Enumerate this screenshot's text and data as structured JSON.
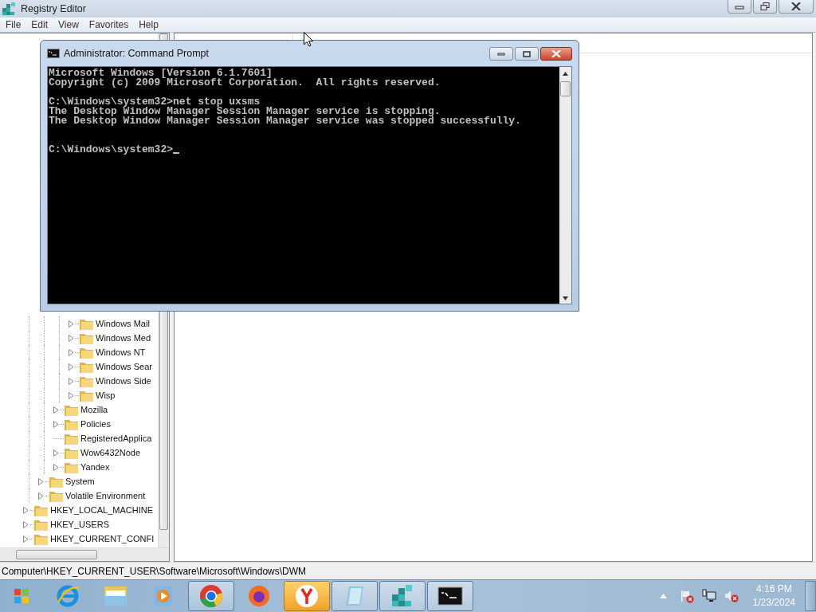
{
  "window": {
    "title": "Registry Editor"
  },
  "menu": [
    "File",
    "Edit",
    "View",
    "Favorites",
    "Help"
  ],
  "tree": [
    {
      "children": [
        {
          "children": [
            {
              "children": [
                {
                  "label": "Windows Mail",
                  "expandable": true
                },
                {
                  "label": "Windows Med",
                  "expandable": true
                },
                {
                  "label": "Windows NT",
                  "expandable": true
                },
                {
                  "label": "Windows Sear",
                  "expandable": true
                },
                {
                  "label": "Windows Side",
                  "expandable": true
                },
                {
                  "label": "Wisp",
                  "expandable": true
                }
              ]
            },
            {
              "label": "Mozilla",
              "expandable": true
            },
            {
              "label": "Policies",
              "expandable": true
            },
            {
              "label": "RegisteredApplica",
              "expandable": false
            },
            {
              "label": "Wow6432Node",
              "expandable": true
            },
            {
              "label": "Yandex",
              "expandable": true
            }
          ]
        },
        {
          "label": "System",
          "expandable": true
        },
        {
          "label": "Volatile Environment",
          "expandable": true
        }
      ]
    },
    {
      "label": "HKEY_LOCAL_MACHINE",
      "expandable": true
    },
    {
      "label": "HKEY_USERS",
      "expandable": true
    },
    {
      "label": "HKEY_CURRENT_CONFI",
      "expandable": true
    }
  ],
  "status_bar": "Computer\\HKEY_CURRENT_USER\\Software\\Microsoft\\Windows\\DWM",
  "console_window": {
    "title": "Administrator: Command Prompt",
    "lines": [
      {
        "kind": "text",
        "text": "Microsoft Windows [Version 6.1.7601]"
      },
      {
        "kind": "text",
        "text": "Copyright (c) 2009 Microsoft Corporation.  All rights reserved."
      },
      {
        "kind": "blank"
      },
      {
        "kind": "text",
        "text": "C:\\Windows\\system32>net stop uxsms"
      },
      {
        "kind": "text",
        "text": "The Desktop Window Manager Session Manager service is stopping."
      },
      {
        "kind": "text",
        "text": "The Desktop Window Manager Session Manager service was stopped successfully."
      },
      {
        "kind": "blank"
      },
      {
        "kind": "blank"
      },
      {
        "kind": "text",
        "text": "C:\\Windows\\system32>",
        "cursor": true
      }
    ]
  },
  "taskbar": {
    "items": [
      {
        "kind": "browser-e",
        "running": false,
        "flashing": false
      },
      {
        "kind": "folders",
        "running": false,
        "flashing": false
      },
      {
        "kind": "player",
        "running": false,
        "flashing": false
      },
      {
        "kind": "ring",
        "running": true,
        "flashing": false
      },
      {
        "kind": "fox",
        "running": false,
        "flashing": false
      },
      {
        "kind": "y",
        "running": true,
        "flashing": true
      },
      {
        "kind": "notepad",
        "running": true,
        "flashing": false
      },
      {
        "kind": "cubes",
        "running": true,
        "flashing": false
      },
      {
        "kind": "console",
        "running": true,
        "flashing": false
      }
    ],
    "time": "4:16 PM",
    "date": "1/23/2024"
  }
}
